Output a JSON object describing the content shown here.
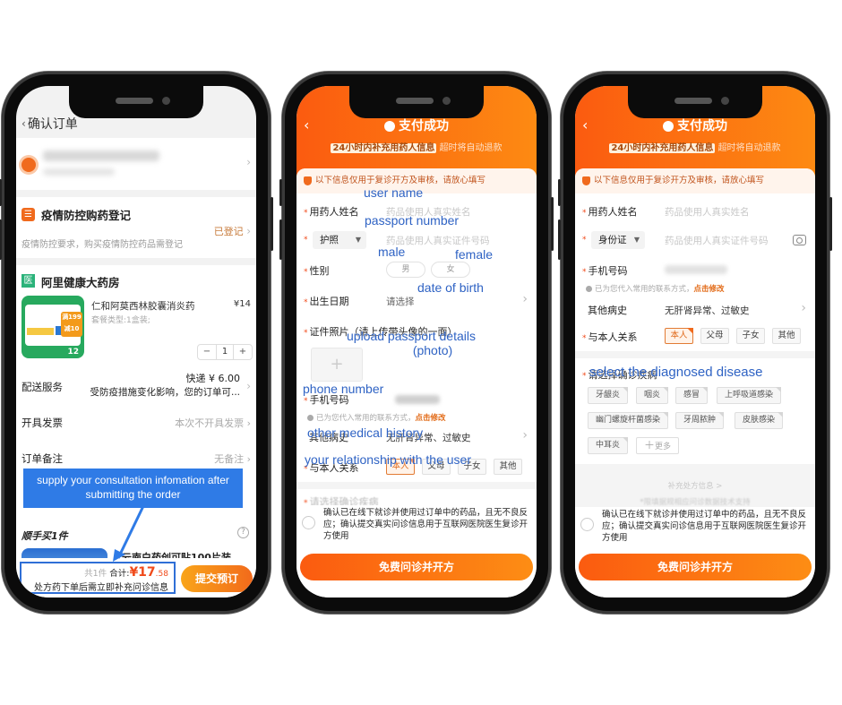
{
  "phone1": {
    "title": "确认订单",
    "back_icon": "back-chevron",
    "epidemic": {
      "title": "疫情防控购药登记",
      "subtitle": "疫情防控要求，购买疫情防控药品需登记",
      "status": "已登记"
    },
    "shop": {
      "name": "阿里健康大药房",
      "icon_label": "医",
      "product": {
        "name": "仁和阿莫西林胶囊消炎药",
        "package": "套餐类型:1盒装;",
        "price": "¥14",
        "quantity": "1",
        "image_badge_top": "满199",
        "image_badge_bottom": "减10",
        "image_count": "12"
      }
    },
    "delivery": {
      "label": "配送服务",
      "fee": "快递 ¥ 6.00",
      "note": "受防疫措施变化影响，您的订单可..."
    },
    "invoice": {
      "label": "开具发票",
      "value": "本次不开具发票"
    },
    "remark": {
      "label": "订单备注",
      "value": "无备注"
    },
    "upsell": {
      "title": "顺手买1件",
      "product_name": "云南白药创可贴100片装"
    },
    "bottom": {
      "count": "共1件",
      "total_label": "合计:",
      "total_big": "¥17",
      "total_small": ".58",
      "note": "处方药下单后需立即补充问诊信息",
      "submit_label": "提交预订"
    },
    "callout": "supply your consultation infomation after submitting the order"
  },
  "consult_form": {
    "header_title": "支付成功",
    "header_highlight": "24小时内补充用药人信息",
    "header_suffix": "超时将自动退款",
    "notice": "以下信息仅用于复诊开方及审核，请放心填写",
    "name_label": "用药人姓名",
    "name_placeholder": "药品使用人真实姓名",
    "id_number_placeholder": "药品使用人真实证件号码",
    "gender_label": "性别",
    "gender_options": [
      "男",
      "女"
    ],
    "dob_label": "出生日期",
    "dob_placeholder": "请选择",
    "photo_label": "证件照片（请上传带头像的一面）",
    "phone_label": "手机号码",
    "phone_hint": "已为您代入常用的联系方式，",
    "phone_hint_link": "点击修改",
    "history_label": "其他病史",
    "history_value": "无肝肾异常、过敏史",
    "relation_label": "与本人关系",
    "relation_options": [
      "本人",
      "父母",
      "子女",
      "其他"
    ],
    "relation_selected": "本人",
    "disease_label": "请选择确诊疾病",
    "disease_tags": [
      "牙龈炎",
      "咽炎",
      "感冒",
      "上呼吸道感染",
      "幽门螺旋杆菌感染",
      "牙周脓肿",
      "皮肤感染",
      "中耳炎"
    ],
    "disease_more": "更多",
    "supplement_link": "补充处方信息 >",
    "supplement_note": "*限填据规相应问诊数据技术支持",
    "consent": "确认已在线下就诊并使用过订单中的药品，且无不良反应；确认提交真实问诊信息用于互联网医院医生复诊开方使用",
    "submit_label": "免费问诊并开方"
  },
  "phone2": {
    "id_type": "护照",
    "annotations": {
      "user_name": "user name",
      "passport_number": "passport number",
      "male": "male",
      "female": "female",
      "dob": "date of birth",
      "upload": "upload passport details\n(photo)",
      "upload_line1": "upload passport details",
      "upload_line2": "(photo)",
      "phone": "phone number",
      "history": "other medical history",
      "relation": "your relationship with the user"
    }
  },
  "phone3": {
    "id_type": "身份证",
    "annotations": {
      "disease": "select the diagnosed disease"
    }
  },
  "colors": {
    "brand_orange": "#fb5b10",
    "callout_blue": "#2f7be6",
    "annotation_blue": "#2f63c4",
    "pharmacy_green": "#2bb37a"
  }
}
